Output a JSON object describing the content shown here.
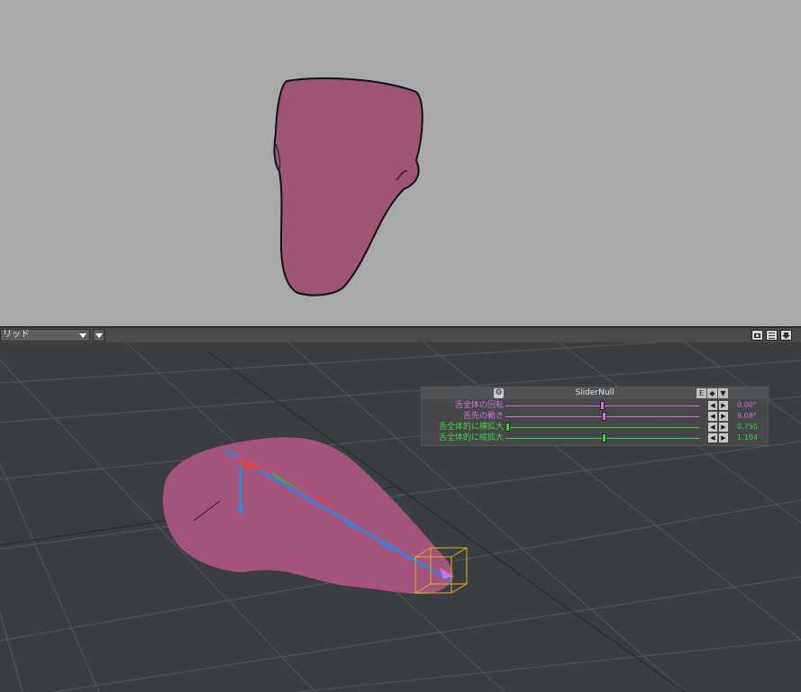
{
  "toolbar": {
    "view_mode": "リッド",
    "icons": [
      "camera-icon",
      "list-icon",
      "save-icon"
    ]
  },
  "slider_panel": {
    "title": "SliderNull",
    "header_buttons": [
      "E",
      "◆",
      "▼"
    ],
    "rows": [
      {
        "label": "舌全体の回転",
        "value": "0.00°",
        "color": "#d86fd8",
        "thumb_fraction": 0.5
      },
      {
        "label": "舌先の動き",
        "value": "9.08°",
        "color": "#d86fd8",
        "thumb_fraction": 0.51
      },
      {
        "label": "舌全体的に横拡大",
        "value": "0.750",
        "color": "#3fd23f",
        "thumb_fraction": 0.0
      },
      {
        "label": "舌全体的に縦拡大",
        "value": "1.104",
        "color": "#3fd23f",
        "thumb_fraction": 0.51
      }
    ]
  },
  "colors": {
    "tongue": "#9e5473",
    "top_background": "#a9a9a9",
    "grid_background": "#3b3e40",
    "null_box": "#e0b020"
  }
}
